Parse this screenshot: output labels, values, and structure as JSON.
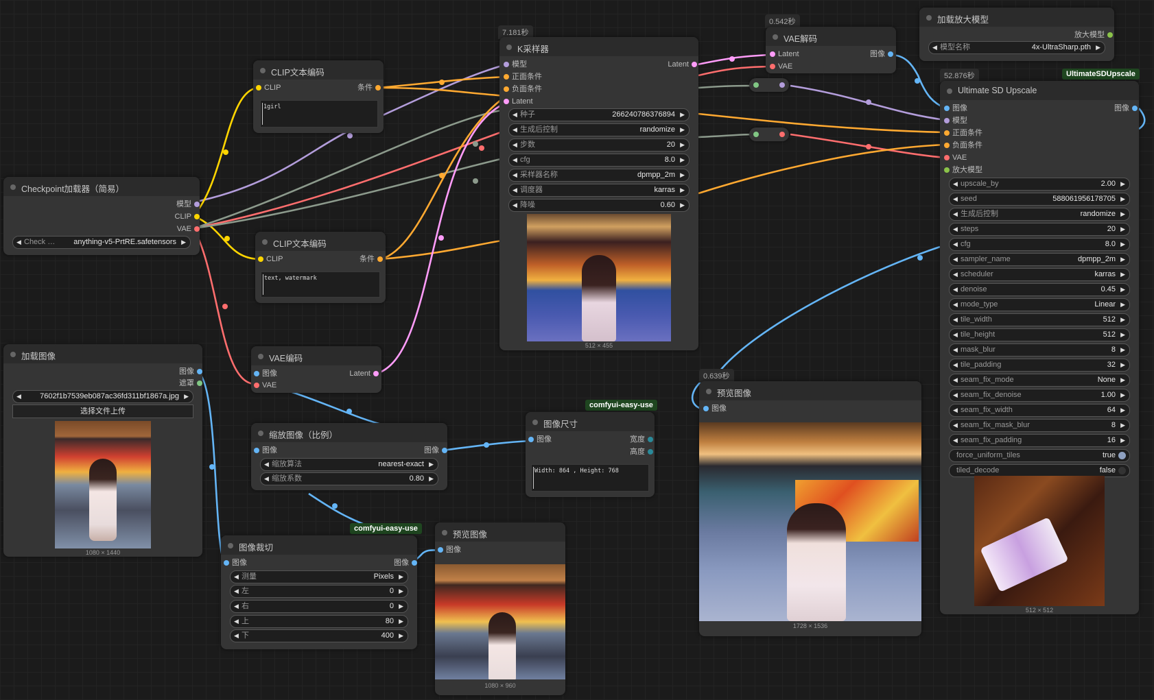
{
  "colors": {
    "model": "#b39ddb",
    "clip": "#ffd500",
    "vae": "#ff6e6e",
    "cond": "#ffa931",
    "latent": "#ff9cf9",
    "image": "#64b5f6",
    "upscale": "#8bc34a",
    "mask": "#81c784",
    "wire_gray": "#8c9a8c"
  },
  "checkpoint": {
    "title": "Checkpoint加载器（简易）",
    "out_model": "模型",
    "out_clip": "CLIP",
    "out_vae": "VAE",
    "widget_label": "Check …",
    "widget_value": "anything-v5-PrtRE.safetensors"
  },
  "clip1": {
    "title": "CLIP文本编码",
    "in_clip": "CLIP",
    "out_cond": "条件",
    "text": "1girl"
  },
  "clip2": {
    "title": "CLIP文本编码",
    "in_clip": "CLIP",
    "out_cond": "条件",
    "text": "text, watermark"
  },
  "vae_encode": {
    "title": "VAE编码",
    "in_image": "图像",
    "in_vae": "VAE",
    "out_latent": "Latent"
  },
  "load_image": {
    "title": "加载图像",
    "out_image": "图像",
    "out_mask": "遮罩",
    "file": "7602f1b7539eb087ac36fd311bf1867a.jpg",
    "upload_label": "选择文件上传",
    "dims": "1080 × 1440"
  },
  "scale_image": {
    "title": "缩放图像（比例）",
    "in_image": "图像",
    "out_image": "图像",
    "method_label": "缩放算法",
    "method_value": "nearest-exact",
    "factor_label": "缩放系数",
    "factor_value": "0.80"
  },
  "crop": {
    "badge": "comfyui-easy-use",
    "title": "图像裁切",
    "in_image": "图像",
    "out_image": "图像",
    "widgets": [
      {
        "label": "测量",
        "value": "Pixels"
      },
      {
        "label": "左",
        "value": "0"
      },
      {
        "label": "右",
        "value": "0"
      },
      {
        "label": "上",
        "value": "80"
      },
      {
        "label": "下",
        "value": "400"
      }
    ]
  },
  "preview_small": {
    "title": "预览图像",
    "in_image": "图像",
    "dims": "1080 × 960"
  },
  "image_size": {
    "badge": "comfyui-easy-use",
    "title": "图像尺寸",
    "in_image": "图像",
    "out_width": "宽度",
    "out_height": "高度",
    "text": "Width: 864 , Height: 768"
  },
  "ksampler": {
    "time": "7.181秒",
    "title": "K采样器",
    "in_model": "模型",
    "in_pos": "正面条件",
    "in_neg": "负面条件",
    "in_latent": "Latent",
    "out_latent": "Latent",
    "widgets": [
      {
        "label": "种子",
        "value": "266240786376894"
      },
      {
        "label": "生成后控制",
        "value": "randomize"
      },
      {
        "label": "步数",
        "value": "20"
      },
      {
        "label": "cfg",
        "value": "8.0"
      },
      {
        "label": "采样器名称",
        "value": "dpmpp_2m"
      },
      {
        "label": "调度器",
        "value": "karras"
      },
      {
        "label": "降噪",
        "value": "0.60"
      }
    ],
    "dims": "512 × 455"
  },
  "vae_decode": {
    "time": "0.542秒",
    "title": "VAE解码",
    "in_latent": "Latent",
    "in_vae": "VAE",
    "out_image": "图像"
  },
  "load_upscale": {
    "title": "加载放大模型",
    "out": "放大模型",
    "widget_label": "模型名称",
    "widget_value": "4x-UltraSharp.pth"
  },
  "usd": {
    "time": "52.876秒",
    "badge": "UltimateSDUpscale",
    "title": "Ultimate SD Upscale",
    "out_image": "图像",
    "inputs": [
      "图像",
      "模型",
      "正面条件",
      "负面条件",
      "VAE",
      "放大模型"
    ],
    "widgets": [
      {
        "label": "upscale_by",
        "value": "2.00"
      },
      {
        "label": "seed",
        "value": "588061956178705"
      },
      {
        "label": "生成后控制",
        "value": "randomize"
      },
      {
        "label": "steps",
        "value": "20"
      },
      {
        "label": "cfg",
        "value": "8.0"
      },
      {
        "label": "sampler_name",
        "value": "dpmpp_2m"
      },
      {
        "label": "scheduler",
        "value": "karras"
      },
      {
        "label": "denoise",
        "value": "0.45"
      },
      {
        "label": "mode_type",
        "value": "Linear"
      },
      {
        "label": "tile_width",
        "value": "512"
      },
      {
        "label": "tile_height",
        "value": "512"
      },
      {
        "label": "mask_blur",
        "value": "8"
      },
      {
        "label": "tile_padding",
        "value": "32"
      },
      {
        "label": "seam_fix_mode",
        "value": "None"
      },
      {
        "label": "seam_fix_denoise",
        "value": "1.00"
      },
      {
        "label": "seam_fix_width",
        "value": "64"
      },
      {
        "label": "seam_fix_mask_blur",
        "value": "8"
      },
      {
        "label": "seam_fix_padding",
        "value": "16"
      }
    ],
    "toggles": [
      {
        "label": "force_uniform_tiles",
        "value": "true"
      },
      {
        "label": "tiled_decode",
        "value": "false"
      }
    ],
    "dims": "512 × 512"
  },
  "preview_big": {
    "time": "0.639秒",
    "title": "预览图像",
    "in_image": "图像",
    "dims": "1728 × 1536"
  }
}
